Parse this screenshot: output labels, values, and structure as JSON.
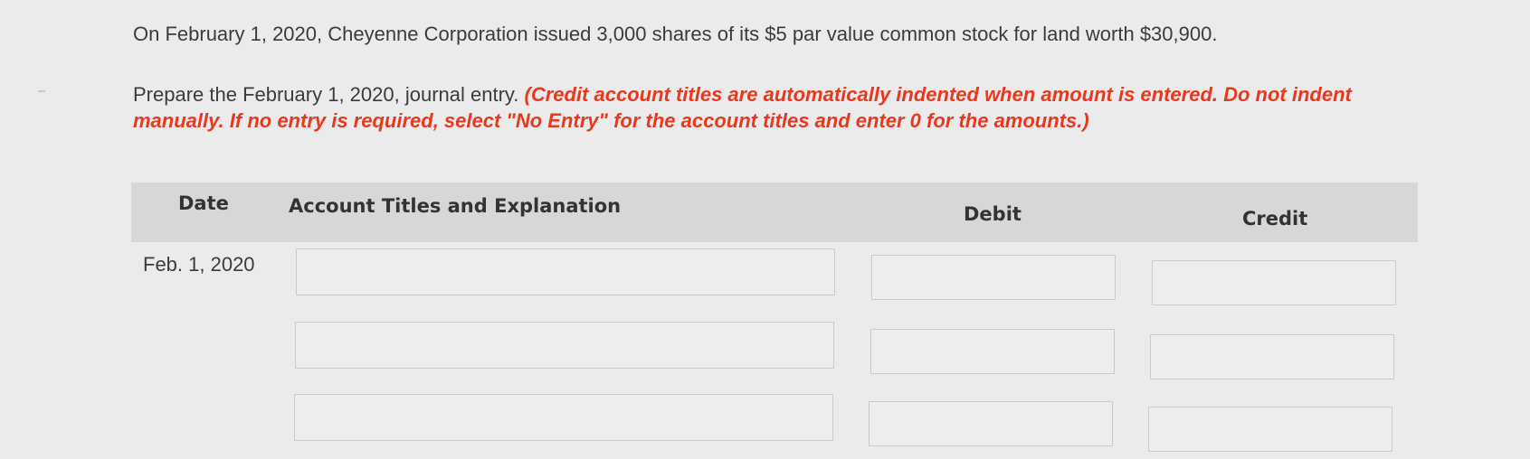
{
  "problem": {
    "statement": "On February 1, 2020, Cheyenne Corporation issued 3,000 shares of its $5 par value common stock for land worth $30,900."
  },
  "instruction": {
    "lead": "Prepare the February 1, 2020, journal entry. ",
    "note": "(Credit account titles are automatically indented when amount is entered. Do not indent manually. If no entry is required, select \"No Entry\" for the account titles and enter 0 for the amounts.)"
  },
  "journal_table": {
    "headers": {
      "date": "Date",
      "account": "Account Titles and Explanation",
      "debit": "Debit",
      "credit": "Credit"
    },
    "date_value": "Feb. 1, 2020",
    "rows": [
      {
        "account": "",
        "debit": "",
        "credit": ""
      },
      {
        "account": "",
        "debit": "",
        "credit": ""
      },
      {
        "account": "",
        "debit": "",
        "credit": ""
      }
    ]
  },
  "colors": {
    "instruction_note": "#e8391f",
    "header_bg": "#d7d7d7",
    "page_bg": "#ebebeb"
  }
}
